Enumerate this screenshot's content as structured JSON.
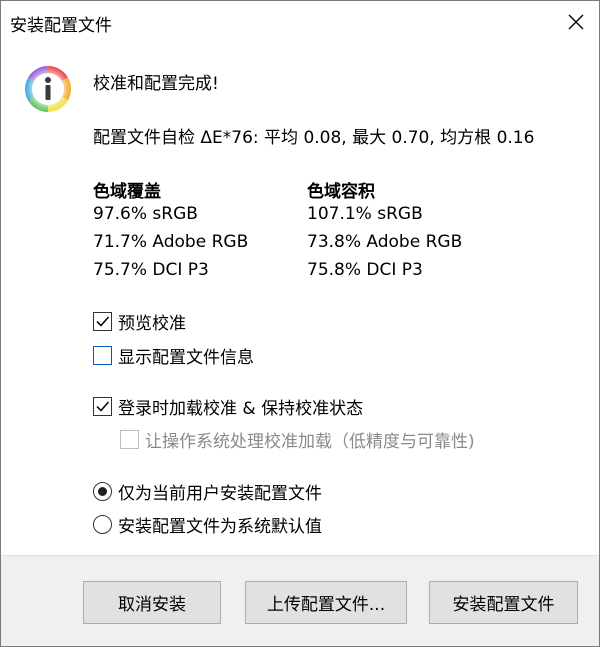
{
  "window": {
    "title": "安装配置文件"
  },
  "icons": {
    "close": "close-icon",
    "info": "info-icon"
  },
  "message": {
    "heading": "校准和配置完成!",
    "stats": "配置文件自检 ΔE*76: 平均 0.08, 最大 0.70, 均方根 0.16"
  },
  "gamut": {
    "coverage": {
      "title": "色域覆盖",
      "lines": [
        "97.6% sRGB",
        "71.7% Adobe RGB",
        "75.7% DCI P3"
      ]
    },
    "volume": {
      "title": "色域容积",
      "lines": [
        "107.1% sRGB",
        "73.8% Adobe RGB",
        "75.8% DCI P3"
      ]
    }
  },
  "options": {
    "preview": {
      "label": "预览校准",
      "checked": true
    },
    "show_info": {
      "label": "显示配置文件信息",
      "checked": false
    },
    "load_on_login": {
      "label": "登录时加载校准 & 保持校准状态",
      "checked": true
    },
    "os_load": {
      "label": "让操作系统处理校准加载（低精度与可靠性)",
      "checked": false,
      "disabled": true
    }
  },
  "install_scope": {
    "current_user": {
      "label": "仅为当前用户安装配置文件",
      "selected": true
    },
    "system_default": {
      "label": "安装配置文件为系统默认值",
      "selected": false
    }
  },
  "buttons": {
    "cancel": "取消安装",
    "upload": "上传配置文件...",
    "install": "安装配置文件"
  },
  "colors": {
    "dialog_bg": "#ffffff",
    "footer_bg": "#f0f0f0",
    "button_bg": "#e1e1e1",
    "focus_blue": "#005fb8"
  }
}
